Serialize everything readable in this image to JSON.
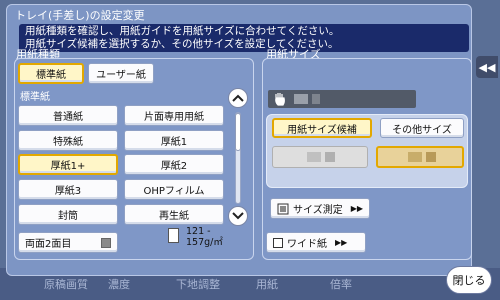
{
  "dialog": {
    "title": "トレイ(手差し)の設定変更",
    "desc_line1": "用紙種類を確認し、用紙ガイドを用紙サイズに合わせてください。",
    "desc_line2": "用紙サイズ候補を選択するか、その他サイズを設定してください。"
  },
  "paper_type": {
    "label": "用紙種類",
    "tab_standard": "標準紙",
    "tab_user": "ユーザー紙",
    "sub_label": "標準紙",
    "items": [
      "普通紙",
      "片面専用用紙",
      "特殊紙",
      "厚紙1",
      "厚紙1+",
      "厚紙2",
      "厚紙3",
      "OHPフィルム",
      "封筒",
      "再生紙"
    ],
    "duplex_label": "両面2面目",
    "weight_text": "121 - 157g/㎡"
  },
  "paper_size": {
    "label": "用紙サイズ",
    "candidate_tab": "用紙サイズ候補",
    "other_tab": "その他サイズ",
    "measure_button": "サイズ測定",
    "wide_button": "ワイド紙"
  },
  "bg_tabs": [
    "原稿画質",
    "濃度",
    "下地調整",
    "用紙",
    "倍率"
  ],
  "close_button": "閉じる",
  "side_tab_icon": "double-chevron-left-icon"
}
